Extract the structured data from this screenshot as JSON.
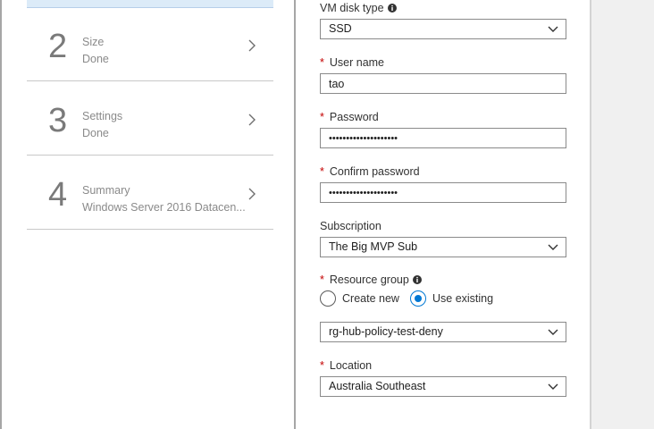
{
  "steps": [
    {
      "number": "2",
      "title": "Size",
      "subtitle": "Done"
    },
    {
      "number": "3",
      "title": "Settings",
      "subtitle": "Done"
    },
    {
      "number": "4",
      "title": "Summary",
      "subtitle": "Windows Server 2016 Datacen..."
    }
  ],
  "form": {
    "disk_type": {
      "label": "VM disk type",
      "value": "SSD"
    },
    "user_name": {
      "label": "User name",
      "value": "tao"
    },
    "password": {
      "label": "Password",
      "value": "••••••••••••••••••••"
    },
    "confirm_password": {
      "label": "Confirm password",
      "value": "••••••••••••••••••••"
    },
    "subscription": {
      "label": "Subscription",
      "value": "The Big MVP Sub"
    },
    "resource_group": {
      "label": "Resource group",
      "option_new": "Create new",
      "option_existing": "Use existing",
      "selected": "Use existing",
      "value": "rg-hub-policy-test-deny"
    },
    "location": {
      "label": "Location",
      "value": "Australia Southeast"
    },
    "required_marker": "*"
  },
  "colors": {
    "accent": "#0078d4",
    "required": "#c40000",
    "active_step": "#dcebf8"
  }
}
